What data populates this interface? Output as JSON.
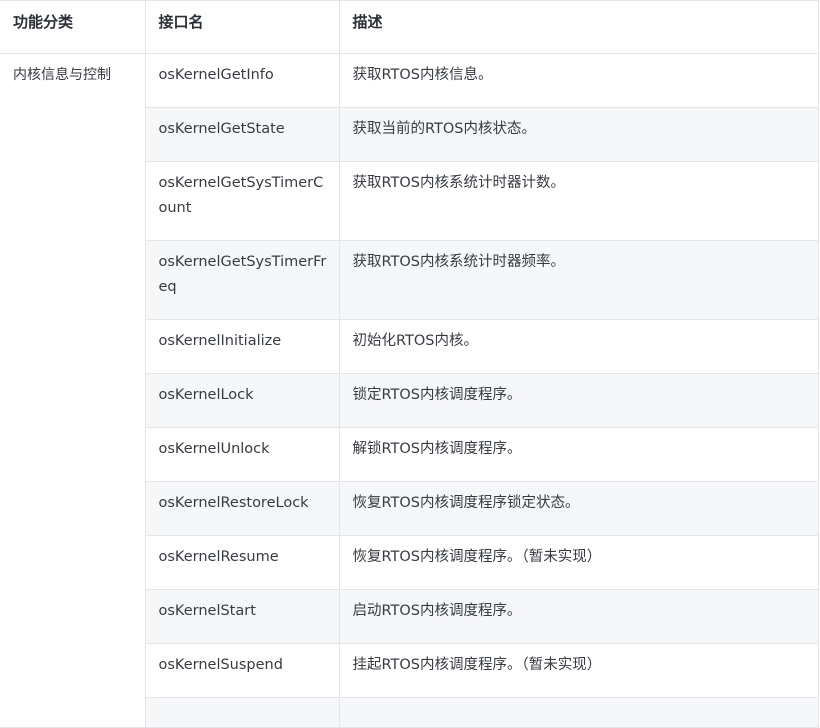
{
  "headers": {
    "category": "功能分类",
    "name": "接口名",
    "desc": "描述"
  },
  "category": "内核信息与控制",
  "rows": [
    {
      "name": "osKernelGetInfo",
      "desc": "获取RTOS内核信息。"
    },
    {
      "name": "osKernelGetState",
      "desc": "获取当前的RTOS内核状态。"
    },
    {
      "name": "osKernelGetSysTimerCount",
      "desc": "获取RTOS内核系统计时器计数。"
    },
    {
      "name": "osKernelGetSysTimerFreq",
      "desc": "获取RTOS内核系统计时器频率。"
    },
    {
      "name": "osKernelInitialize",
      "desc": "初始化RTOS内核。"
    },
    {
      "name": "osKernelLock",
      "desc": "锁定RTOS内核调度程序。"
    },
    {
      "name": "osKernelUnlock",
      "desc": "解锁RTOS内核调度程序。"
    },
    {
      "name": "osKernelRestoreLock",
      "desc": "恢复RTOS内核调度程序锁定状态。"
    },
    {
      "name": "osKernelResume",
      "desc": "恢复RTOS内核调度程序。（暂未实现）"
    },
    {
      "name": "osKernelStart",
      "desc": "启动RTOS内核调度程序。"
    },
    {
      "name": "osKernelSuspend",
      "desc": "挂起RTOS内核调度程序。（暂未实现）"
    }
  ]
}
